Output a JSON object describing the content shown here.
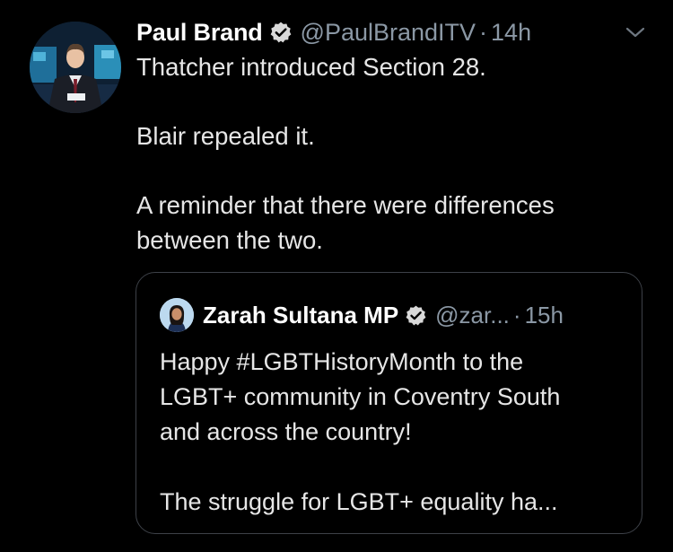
{
  "tweet": {
    "author_name": "Paul Brand",
    "author_handle": "@PaulBrandITV",
    "separator": "·",
    "time": "14h",
    "lines": {
      "l1": "Thatcher introduced Section 28.",
      "l2": "Blair repealed it.",
      "l3": "A reminder that there were differences",
      "l4": "between the two."
    },
    "icons": {
      "verified": "verified-badge-icon",
      "menu": "chevron-down-icon"
    }
  },
  "quoted_tweet": {
    "author_name": "Zarah Sultana MP",
    "author_handle": "@zar...",
    "separator": "·",
    "time": "15h",
    "lines": {
      "l1": "Happy #LGBTHistoryMonth to the",
      "l2": "LGBT+ community in Coventry South",
      "l3": "and across the country!",
      "l4": "The struggle for LGBT+ equality ha..."
    }
  },
  "colors": {
    "background": "#000000",
    "name_text": "#ffffff",
    "secondary_text": "#8b98a5",
    "body_text": "#e6e6e6",
    "quote_border": "#3d4148",
    "verified_badge": "#d9d9d9"
  }
}
